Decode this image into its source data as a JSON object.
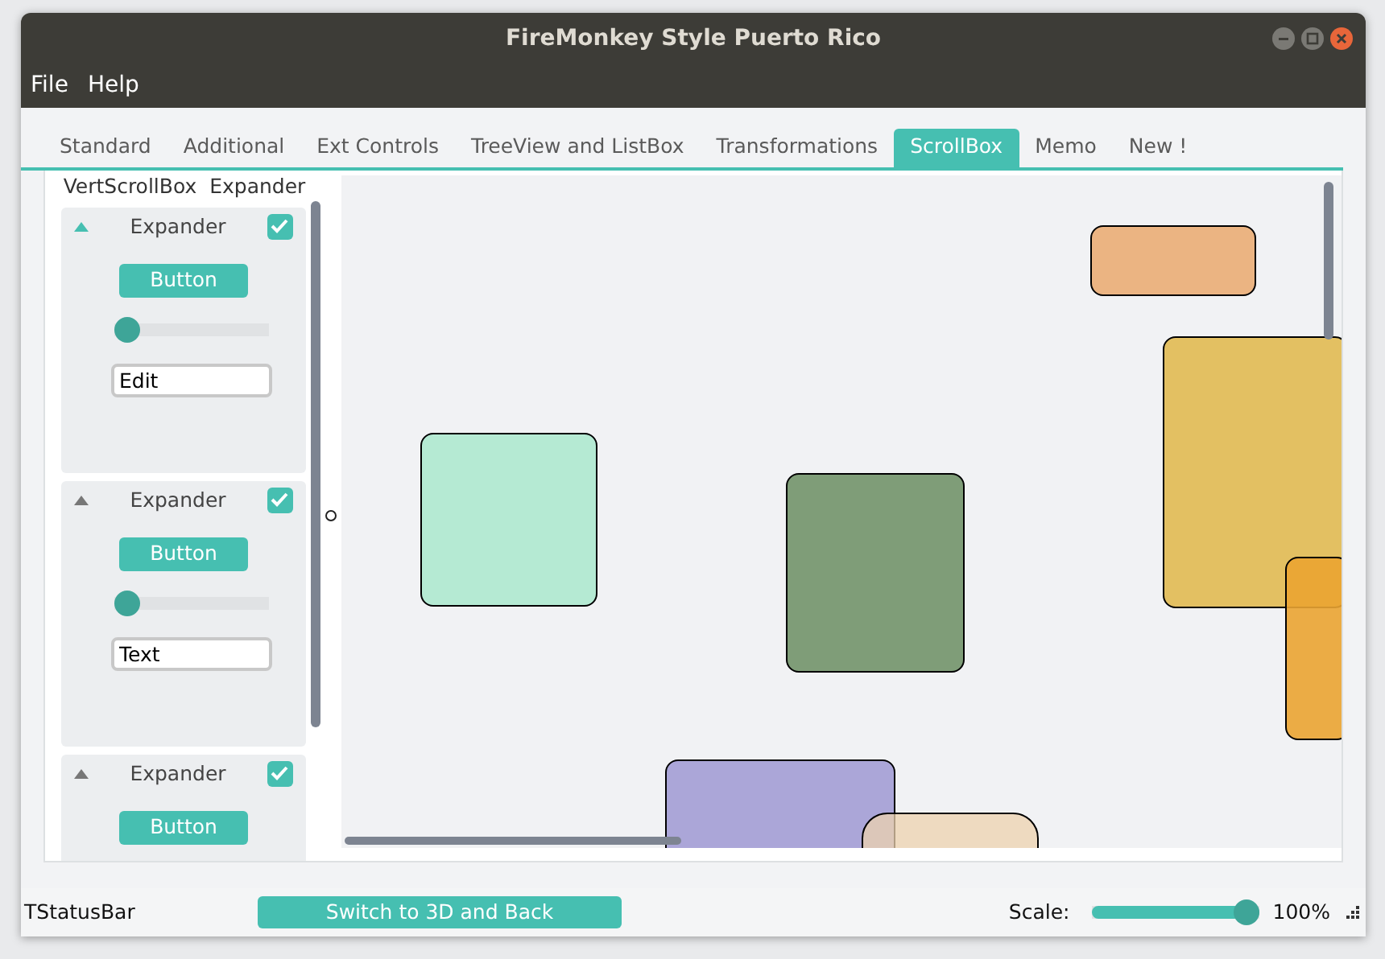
{
  "window": {
    "title": "FireMonkey Style Puerto Rico"
  },
  "menu": [
    "File",
    "Help"
  ],
  "tabs": [
    {
      "label": "Standard",
      "selected": false
    },
    {
      "label": "Additional",
      "selected": false
    },
    {
      "label": "Ext Controls",
      "selected": false
    },
    {
      "label": "TreeView and ListBox",
      "selected": false
    },
    {
      "label": "Transformations",
      "selected": false
    },
    {
      "label": "ScrollBox",
      "selected": true
    },
    {
      "label": "Memo",
      "selected": false
    },
    {
      "label": "New !",
      "selected": false
    }
  ],
  "left_panel": {
    "header": "VertScrollBox  Expander",
    "expanders": [
      {
        "title": "Expander",
        "checked": true,
        "expanded": true,
        "button": "Button",
        "level": 0,
        "field": "Edit"
      },
      {
        "title": "Expander",
        "checked": true,
        "expanded": true,
        "button": "Button",
        "level": 0,
        "field": "Text"
      },
      {
        "title": "Expander",
        "checked": true,
        "expanded": true,
        "button": "Button"
      }
    ]
  },
  "status_bar": {
    "label": "TStatusBar",
    "button": "Switch to 3D and Back",
    "scale_label": "Scale:",
    "scale": {
      "level": 1
    },
    "reading": "100%"
  }
}
